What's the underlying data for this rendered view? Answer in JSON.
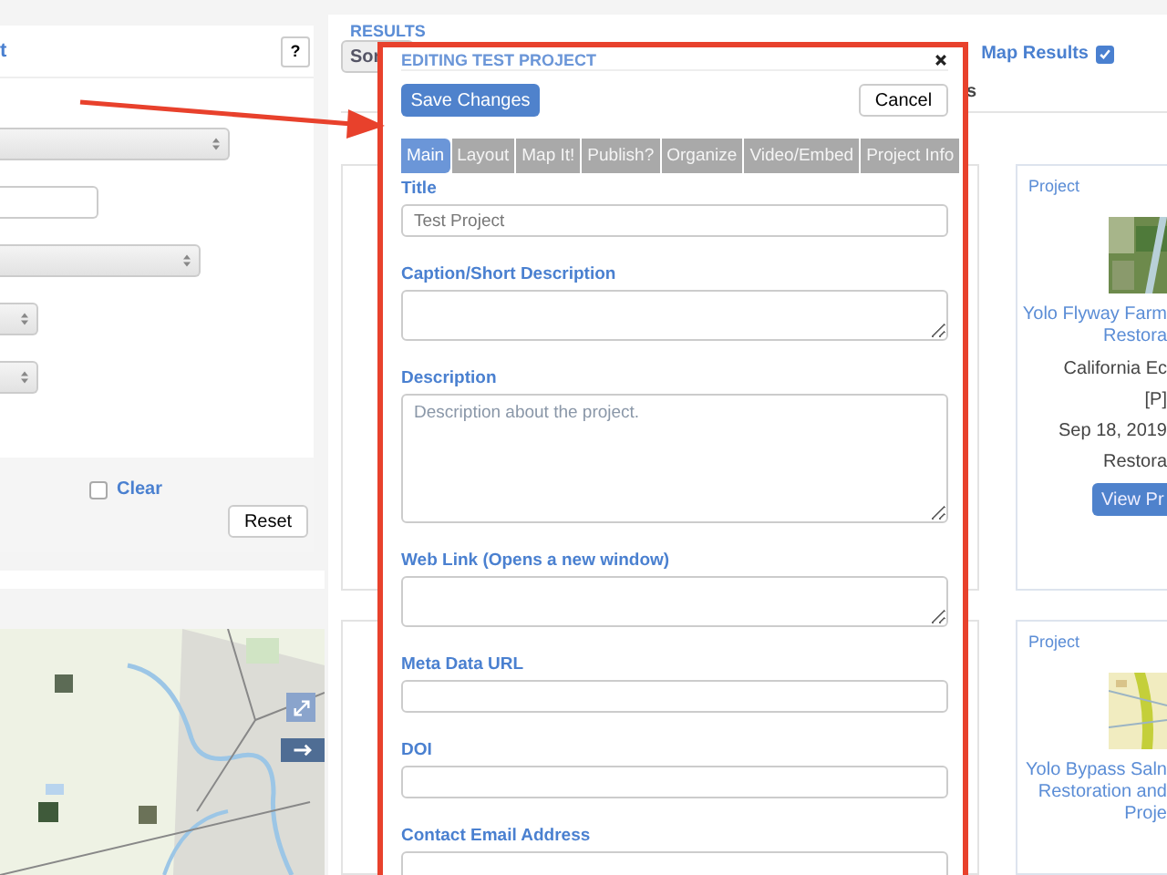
{
  "left_panel": {
    "header_link": "t",
    "help_button": "?",
    "filters": [
      {
        "kind": "select"
      },
      {
        "kind": "input"
      },
      {
        "kind": "select"
      },
      {
        "kind": "select"
      },
      {
        "kind": "select"
      }
    ],
    "clear_checkbox": {
      "label": "Clear",
      "checked": false
    },
    "reset_button": "Reset"
  },
  "results": {
    "title": "RESULTS",
    "sort_button": "Sor",
    "tab_fragment": "s",
    "map_results": {
      "label": "Map Results",
      "checked": true
    },
    "cards": [
      {
        "type_label": "Project",
        "title_lines": [
          "Yolo Flyway Farm",
          "Restora"
        ],
        "lines": [
          "California Ec",
          "[P]",
          "Sep 18, 2019",
          "Restora"
        ],
        "button": "View Pr"
      },
      {
        "type_label": "Project",
        "title_lines": [
          "Yolo Bypass Saln",
          "Restoration and",
          "Proje"
        ]
      }
    ]
  },
  "modal": {
    "title": "EDITING TEST PROJECT",
    "save_button": "Save Changes",
    "cancel_button": "Cancel",
    "tabs": [
      {
        "label": "Main",
        "selected": true
      },
      {
        "label": "Layout",
        "selected": false
      },
      {
        "label": "Map It!",
        "selected": false
      },
      {
        "label": "Publish?",
        "selected": false
      },
      {
        "label": "Organize",
        "selected": false
      },
      {
        "label": "Video/Embed",
        "selected": false
      },
      {
        "label": "Project Info",
        "selected": false
      }
    ],
    "fields": [
      {
        "label": "Title",
        "kind": "input",
        "value": "Test Project"
      },
      {
        "label": "Caption/Short Description",
        "kind": "textarea"
      },
      {
        "label": "Description",
        "kind": "large-textarea",
        "placeholder": "Description about the project."
      },
      {
        "label": "Web Link (Opens a new window)",
        "kind": "textarea"
      },
      {
        "label": "Meta Data URL",
        "kind": "input"
      },
      {
        "label": "DOI",
        "kind": "input"
      },
      {
        "label": "Contact Email Address",
        "kind": "textarea"
      }
    ]
  }
}
